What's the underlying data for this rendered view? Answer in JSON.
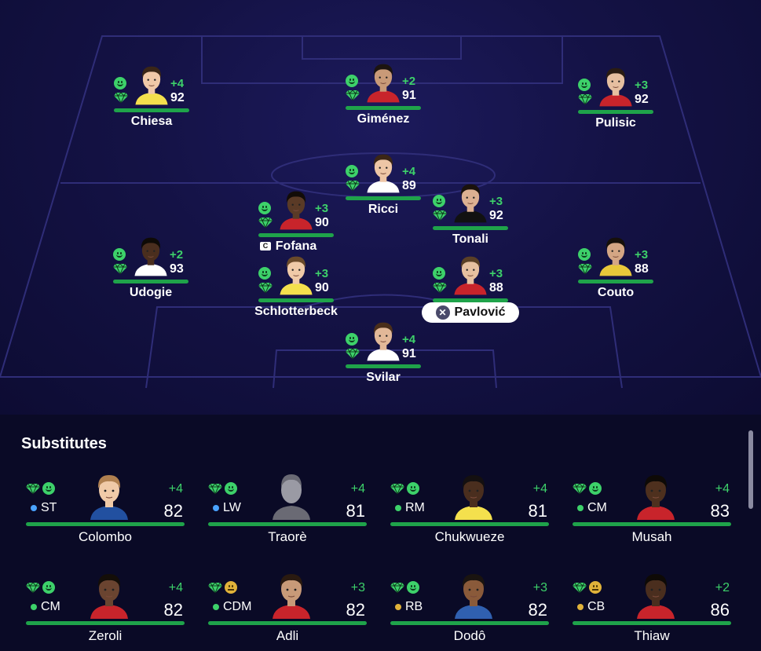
{
  "lineup": {
    "players": [
      {
        "name": "Chiesa",
        "rating": "92",
        "delta": "+4",
        "skin": "#f0c8a8",
        "hair": "#3a2617",
        "shirt": "#f4e04d"
      },
      {
        "name": "Giménez",
        "rating": "91",
        "delta": "+2",
        "skin": "#c99a78",
        "hair": "#1c1410",
        "shirt": "#c8242b"
      },
      {
        "name": "Pulisic",
        "rating": "92",
        "delta": "+3",
        "skin": "#e6bfa0",
        "hair": "#2a1c12",
        "shirt": "#c8242b"
      },
      {
        "name": "Ricci",
        "rating": "89",
        "delta": "+4",
        "skin": "#eec6a6",
        "hair": "#3b2616",
        "shirt": "#ffffff"
      },
      {
        "name": "Fofana",
        "rating": "90",
        "delta": "+3",
        "skin": "#5a3a26",
        "hair": "#120c08",
        "shirt": "#c8242b",
        "captain": "C"
      },
      {
        "name": "Tonali",
        "rating": "92",
        "delta": "+3",
        "skin": "#dcb092",
        "hair": "#1a120c",
        "shirt": "#111111"
      },
      {
        "name": "Udogie",
        "rating": "93",
        "delta": "+2",
        "skin": "#4a2e1e",
        "hair": "#0e0a06",
        "shirt": "#ffffff"
      },
      {
        "name": "Couto",
        "rating": "88",
        "delta": "+3",
        "skin": "#d4a684",
        "hair": "#16100a",
        "shirt": "#e8c83a"
      },
      {
        "name": "Schlotterbeck",
        "rating": "90",
        "delta": "+3",
        "skin": "#f0caa8",
        "hair": "#6a4a2a",
        "shirt": "#f4e04d"
      },
      {
        "name": "Pavlović",
        "rating": "88",
        "delta": "+3",
        "skin": "#e6c0a0",
        "hair": "#5a4026",
        "shirt": "#c8242b",
        "selected": true
      },
      {
        "name": "Svilar",
        "rating": "91",
        "delta": "+4",
        "skin": "#e2b898",
        "hair": "#4a2e1a",
        "shirt": "#ffffff"
      }
    ]
  },
  "substitutes": {
    "title": "Substitutes",
    "players": [
      {
        "name": "Colombo",
        "position": "ST",
        "pos_color": "#4aa3ff",
        "rating": "82",
        "delta": "+4",
        "mood": "happy",
        "skin": "#f0caa8",
        "hair": "#b08050",
        "shirt": "#2250a0"
      },
      {
        "name": "Traorè",
        "position": "LW",
        "pos_color": "#4aa3ff",
        "rating": "81",
        "delta": "+4",
        "mood": "happy",
        "placeholder": true,
        "skin": "#9a9aa4",
        "hair": "#6a6a74",
        "shirt": "#6a6a74"
      },
      {
        "name": "Chukwueze",
        "position": "RM",
        "pos_color": "#3dd16a",
        "rating": "81",
        "delta": "+4",
        "mood": "happy",
        "skin": "#4a2e1e",
        "hair": "#141010",
        "shirt": "#f4e04d"
      },
      {
        "name": "Musah",
        "position": "CM",
        "pos_color": "#3dd16a",
        "rating": "83",
        "delta": "+4",
        "mood": "happy",
        "skin": "#4e301e",
        "hair": "#0e0a06",
        "shirt": "#c8242b"
      },
      {
        "name": "Zeroli",
        "position": "CM",
        "pos_color": "#3dd16a",
        "rating": "82",
        "delta": "+4",
        "mood": "happy",
        "skin": "#6a4430",
        "hair": "#140e08",
        "shirt": "#c8242b"
      },
      {
        "name": "Adli",
        "position": "CDM",
        "pos_color": "#3dd16a",
        "rating": "82",
        "delta": "+3",
        "mood": "neutral",
        "skin": "#c89a78",
        "hair": "#2a1a10",
        "shirt": "#c8242b"
      },
      {
        "name": "Dodô",
        "position": "RB",
        "pos_color": "#e0b23a",
        "rating": "82",
        "delta": "+3",
        "mood": "happy",
        "skin": "#8a5a3a",
        "hair": "#1a1410",
        "shirt": "#3060b0"
      },
      {
        "name": "Thiaw",
        "position": "CB",
        "pos_color": "#e0b23a",
        "rating": "86",
        "delta": "+2",
        "mood": "neutral",
        "skin": "#4a2e1e",
        "hair": "#0e0a06",
        "shirt": "#c8242b"
      }
    ]
  },
  "colors": {
    "accent_green": "#3dd16a",
    "bar_green": "#1fa34a",
    "background": "#0a0a26"
  }
}
